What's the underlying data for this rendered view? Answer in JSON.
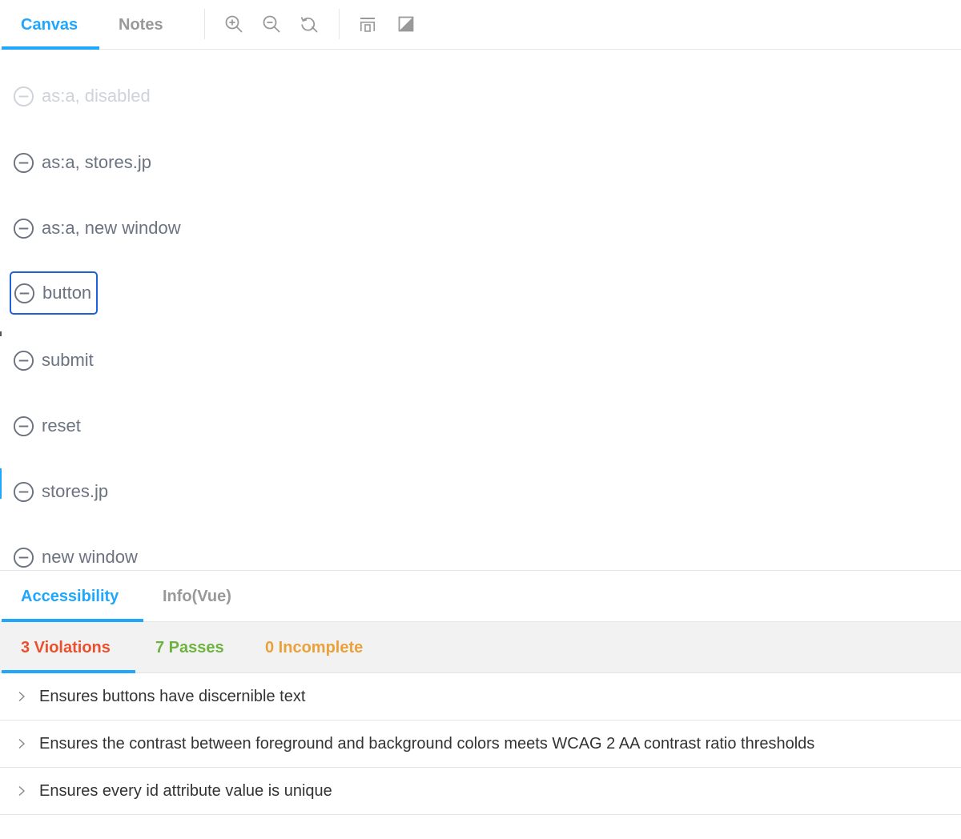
{
  "toolbar": {
    "tabs": [
      {
        "label": "Canvas",
        "active": true
      },
      {
        "label": "Notes",
        "active": false
      }
    ],
    "tools": [
      "zoom-in-icon",
      "zoom-out-icon",
      "reset-zoom-icon",
      "viewport-icon",
      "background-icon"
    ]
  },
  "canvas": {
    "items": [
      {
        "label": "as:a, disabled",
        "disabled": true
      },
      {
        "label": "as:a, stores.jp",
        "disabled": false
      },
      {
        "label": "as:a, new window",
        "disabled": false
      },
      {
        "label": "button",
        "disabled": false,
        "focused": true
      },
      {
        "label": "submit",
        "disabled": false
      },
      {
        "label": "reset",
        "disabled": false
      },
      {
        "label": "stores.jp",
        "disabled": false
      },
      {
        "label": "new window",
        "disabled": false
      }
    ]
  },
  "panel": {
    "tabs": [
      {
        "label": "Accessibility",
        "active": true
      },
      {
        "label": "Info(Vue)",
        "active": false
      }
    ],
    "results": {
      "violations": "3 Violations",
      "passes": "7 Passes",
      "incomplete": "0 Incomplete"
    },
    "rules": [
      "Ensures buttons have discernible text",
      "Ensures the contrast between foreground and background colors meets WCAG 2 AA contrast ratio thresholds",
      "Ensures every id attribute value is unique"
    ]
  },
  "colors": {
    "accent": "#1ea7fd",
    "violations": "#e9502b",
    "passes": "#6db33f",
    "incomplete": "#e9a23b",
    "focus_ring": "#1f62d8"
  }
}
